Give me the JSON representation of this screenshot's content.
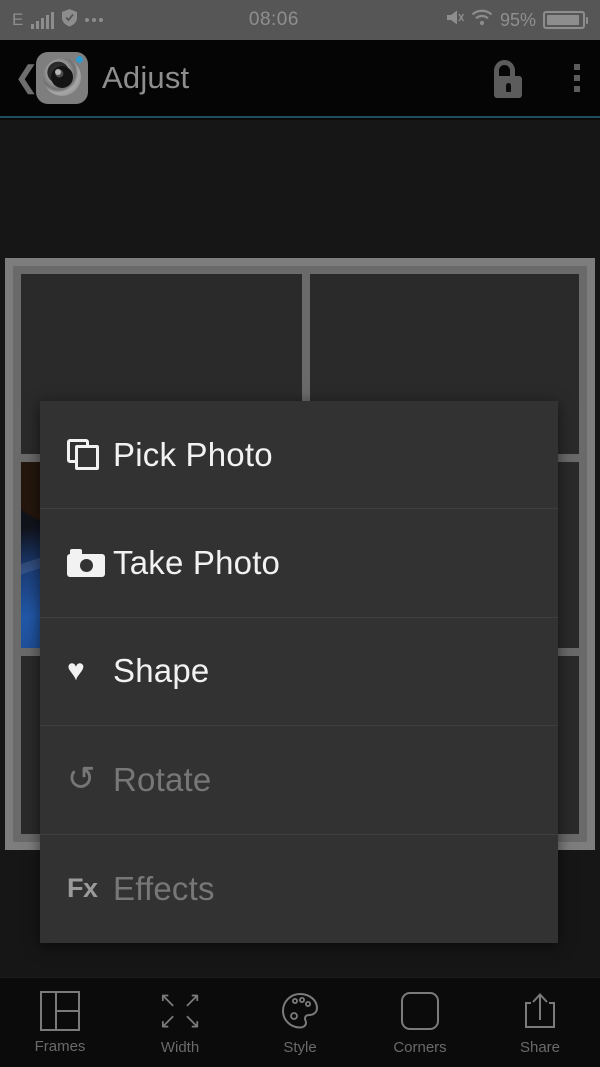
{
  "status_bar": {
    "network_type": "E",
    "signal_icon": "signal-bars-icon",
    "shield_icon": "shield-icon",
    "more_icon": "more-dots-icon",
    "time": "08:06",
    "mute_icon": "mute-icon",
    "wifi_icon": "wifi-icon",
    "battery_percent": "95%",
    "battery_icon": "battery-icon"
  },
  "app_bar": {
    "back_icon": "back-chevron-icon",
    "app_icon": "camera-lens-app-icon",
    "title": "Adjust",
    "lock_icon": "unlock-padlock-icon",
    "overflow_icon": "overflow-menu-icon"
  },
  "popup_menu": {
    "items": [
      {
        "label": "Pick Photo",
        "icon": "photo-stack-icon",
        "enabled": true
      },
      {
        "label": "Take Photo",
        "icon": "camera-icon",
        "enabled": true
      },
      {
        "label": "Shape",
        "icon": "heart-icon",
        "enabled": true
      },
      {
        "label": "Rotate",
        "icon": "rotate-ccw-icon",
        "enabled": false
      },
      {
        "label": "Effects",
        "icon": "fx-icon",
        "enabled": false
      }
    ],
    "fx_glyph": "Fx",
    "heart_glyph": "♥",
    "rotate_glyph": "↺"
  },
  "tab_bar": {
    "tabs": [
      {
        "label": "Frames",
        "icon": "frames-grid-icon"
      },
      {
        "label": "Width",
        "icon": "expand-arrows-icon"
      },
      {
        "label": "Style",
        "icon": "palette-icon"
      },
      {
        "label": "Corners",
        "icon": "rounded-square-icon"
      },
      {
        "label": "Share",
        "icon": "share-upload-icon"
      }
    ],
    "arrow_tl": "↖",
    "arrow_tr": "↗",
    "arrow_bl": "↙",
    "arrow_br": "↘"
  },
  "colors": {
    "status_bar_bg": "#565656",
    "app_bar_bg": "#050505",
    "accent_underline": "#1f4e5c",
    "menu_bg": "#323232",
    "menu_text": "#f2f2f2",
    "menu_text_disabled": "#777777",
    "collage_frame": "#7d7d7d",
    "tab_bar_bg": "#0b0b0b",
    "tab_icon": "#7b7b7b",
    "app_icon_dot": "#2e9ad0"
  }
}
